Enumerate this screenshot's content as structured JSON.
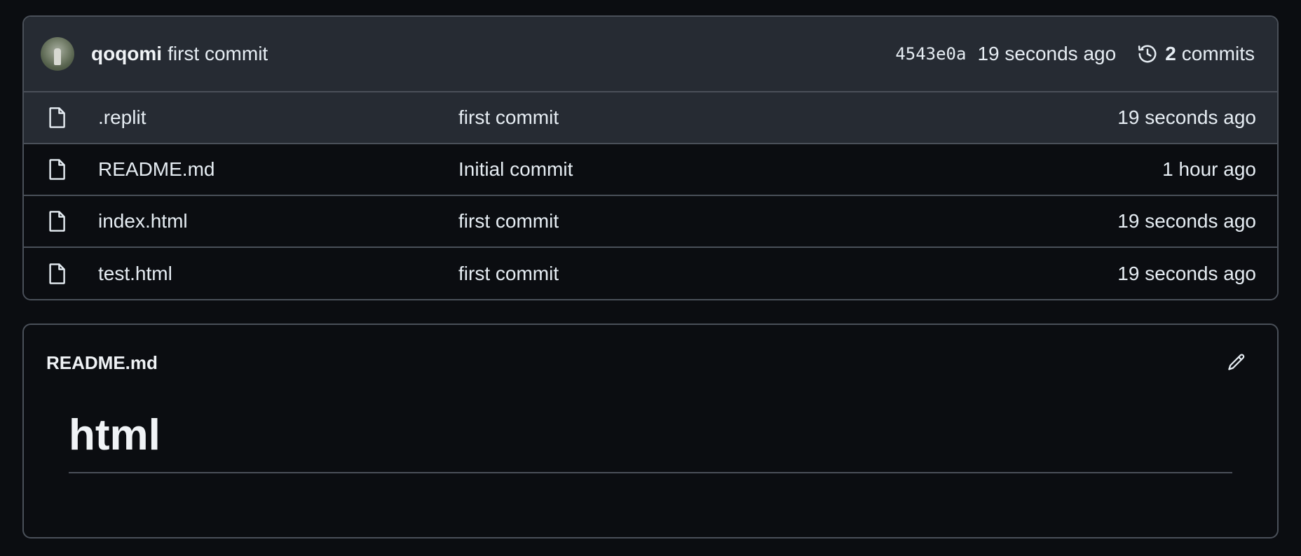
{
  "latest_commit": {
    "author": "qoqomi",
    "message": "first commit",
    "sha": "4543e0a",
    "time": "19 seconds ago",
    "commit_count": "2",
    "commits_label": "commits"
  },
  "files": [
    {
      "name": ".replit",
      "message": "first commit",
      "time": "19 seconds ago"
    },
    {
      "name": "README.md",
      "message": "Initial commit",
      "time": "1 hour ago"
    },
    {
      "name": "index.html",
      "message": "first commit",
      "time": "19 seconds ago"
    },
    {
      "name": "test.html",
      "message": "first commit",
      "time": "19 seconds ago"
    }
  ],
  "readme": {
    "title": "README.md",
    "heading": "html"
  },
  "icons": {
    "file": "file-icon",
    "history": "history-icon",
    "edit": "pencil-icon"
  },
  "colors": {
    "background": "#0b0d11",
    "header_bg": "#262b33",
    "border": "#4a5059",
    "text": "#e6edf3"
  }
}
